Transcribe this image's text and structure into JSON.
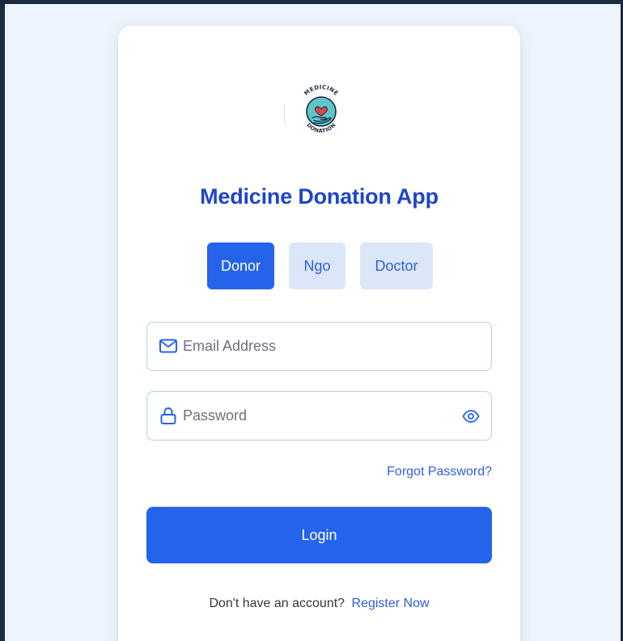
{
  "app": {
    "title": "Medicine Donation App"
  },
  "logo": {
    "top_text": "MEDICINE",
    "bottom_text": "DONATION"
  },
  "roles": [
    {
      "label": "Donor",
      "selected": true
    },
    {
      "label": "Ngo",
      "selected": false
    },
    {
      "label": "Doctor",
      "selected": false
    }
  ],
  "form": {
    "email": {
      "placeholder": "Email Address",
      "value": "",
      "icon": "mail-icon"
    },
    "password": {
      "placeholder": "Password",
      "value": "",
      "icon": "lock-icon",
      "toggle_icon": "eye-icon"
    }
  },
  "forgot_password": "Forgot Password?",
  "login_button": "Login",
  "register": {
    "prompt": "Don't have an account?",
    "link": "Register Now"
  },
  "colors": {
    "accent": "#2563eb",
    "title": "#1f45c9",
    "inactive_role_bg": "#dbe7f8",
    "page_bg": "#eef4fd",
    "frame": "#1c2a3f",
    "logo_teal": "#5ec6c9",
    "logo_heart": "#e0464b"
  }
}
